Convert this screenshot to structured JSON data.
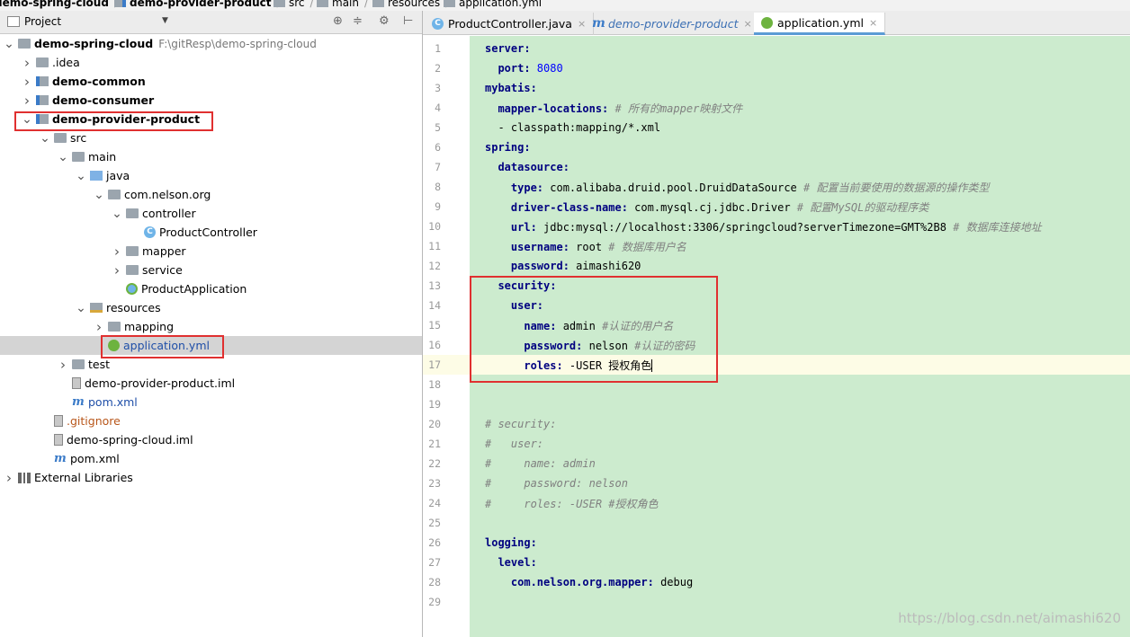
{
  "breadcrumb": [
    "demo-spring-cloud",
    "demo-provider-product",
    "src",
    "main",
    "resources",
    "application.yml"
  ],
  "project_panel": {
    "title": "Project"
  },
  "tree": [
    {
      "label": "demo-spring-cloud",
      "path": "F:\\gitResp\\demo-spring-cloud",
      "bold": true,
      "arrow": "open",
      "icon": "folder-icon",
      "depth": 0
    },
    {
      "label": ".idea",
      "arrow": "closed",
      "icon": "folder-icon",
      "depth": 1
    },
    {
      "label": "demo-common",
      "bold": true,
      "arrow": "closed",
      "icon": "module-folder-icon",
      "depth": 1
    },
    {
      "label": "demo-consumer",
      "bold": true,
      "arrow": "closed",
      "icon": "module-folder-icon",
      "depth": 1
    },
    {
      "label": "demo-provider-product",
      "bold": true,
      "arrow": "open",
      "icon": "module-folder-icon",
      "depth": 1
    },
    {
      "label": "src",
      "arrow": "open",
      "icon": "folder-icon",
      "depth": 2
    },
    {
      "label": "main",
      "arrow": "open",
      "icon": "folder-icon",
      "depth": 3
    },
    {
      "label": "java",
      "arrow": "open",
      "icon": "source-folder-icon",
      "depth": 4
    },
    {
      "label": "com.nelson.org",
      "arrow": "open",
      "icon": "package-icon",
      "depth": 5
    },
    {
      "label": "controller",
      "arrow": "open",
      "icon": "package-icon",
      "depth": 6
    },
    {
      "label": "ProductController",
      "arrow": "",
      "icon": "class-icon",
      "depth": 7
    },
    {
      "label": "mapper",
      "arrow": "closed",
      "icon": "package-icon",
      "depth": 6
    },
    {
      "label": "service",
      "arrow": "closed",
      "icon": "package-icon",
      "depth": 6
    },
    {
      "label": "ProductApplication",
      "arrow": "",
      "icon": "spring-class-icon",
      "depth": 6
    },
    {
      "label": "resources",
      "arrow": "open",
      "icon": "resources-folder-icon",
      "depth": 4
    },
    {
      "label": "mapping",
      "arrow": "closed",
      "icon": "folder-icon",
      "depth": 5
    },
    {
      "label": "application.yml",
      "arrow": "",
      "icon": "spring-yml-icon",
      "depth": 5,
      "selected": true,
      "blue": true
    },
    {
      "label": "test",
      "arrow": "closed",
      "icon": "folder-icon",
      "depth": 3
    },
    {
      "label": "demo-provider-product.iml",
      "arrow": "",
      "icon": "iml-file-icon",
      "depth": 3
    },
    {
      "label": "pom.xml",
      "arrow": "",
      "icon": "maven-icon",
      "depth": 3,
      "blue": true
    },
    {
      "label": ".gitignore",
      "arrow": "",
      "icon": "file-icon",
      "depth": 2,
      "orange": true
    },
    {
      "label": "demo-spring-cloud.iml",
      "arrow": "",
      "icon": "iml-file-icon",
      "depth": 2
    },
    {
      "label": "pom.xml",
      "arrow": "",
      "icon": "maven-icon",
      "depth": 2
    },
    {
      "label": "External Libraries",
      "arrow": "closed",
      "icon": "libraries-icon",
      "depth": 0
    }
  ],
  "tabs": [
    {
      "label": "ProductController.java",
      "icon": "C",
      "active": false
    },
    {
      "label": "demo-provider-product",
      "icon": "m",
      "active": false,
      "italic": true
    },
    {
      "label": "application.yml",
      "icon": "spring",
      "active": true
    }
  ],
  "close_glyph": "×",
  "code_lines": [
    [
      {
        "t": "server:",
        "c": "k"
      }
    ],
    [
      {
        "t": "  port: ",
        "c": "k"
      },
      {
        "t": "8080",
        "c": "n"
      }
    ],
    [
      {
        "t": "mybatis:",
        "c": "k"
      }
    ],
    [
      {
        "t": "  mapper-locations: ",
        "c": "k"
      },
      {
        "t": "# 所有的mapper映射文件",
        "c": "cm"
      }
    ],
    [
      {
        "t": "  - classpath:mapping/*.xml",
        "c": "v"
      }
    ],
    [
      {
        "t": "spring:",
        "c": "k"
      }
    ],
    [
      {
        "t": "  datasource:",
        "c": "k"
      }
    ],
    [
      {
        "t": "    type: ",
        "c": "k"
      },
      {
        "t": "com.alibaba.druid.pool.DruidDataSource ",
        "c": "v"
      },
      {
        "t": "# 配置当前要使用的数据源的操作类型",
        "c": "cm"
      }
    ],
    [
      {
        "t": "    driver-class-name: ",
        "c": "k"
      },
      {
        "t": "com.mysql.cj.jdbc.Driver ",
        "c": "v"
      },
      {
        "t": "# 配置MySQL的驱动程序类",
        "c": "cm"
      }
    ],
    [
      {
        "t": "    url: ",
        "c": "k"
      },
      {
        "t": "jdbc:mysql://localhost:3306/springcloud?serverTimezone=GMT%2B8 ",
        "c": "v"
      },
      {
        "t": "# 数据库连接地址",
        "c": "cm"
      }
    ],
    [
      {
        "t": "    username: ",
        "c": "k"
      },
      {
        "t": "root ",
        "c": "v"
      },
      {
        "t": "# 数据库用户名",
        "c": "cm"
      }
    ],
    [
      {
        "t": "    password: ",
        "c": "k"
      },
      {
        "t": "aimashi620",
        "c": "v"
      }
    ],
    [
      {
        "t": "  security:",
        "c": "k"
      }
    ],
    [
      {
        "t": "    user:",
        "c": "k"
      }
    ],
    [
      {
        "t": "      name: ",
        "c": "k"
      },
      {
        "t": "admin ",
        "c": "v"
      },
      {
        "t": "#认证的用户名",
        "c": "cm"
      }
    ],
    [
      {
        "t": "      password: ",
        "c": "k"
      },
      {
        "t": "nelson ",
        "c": "v"
      },
      {
        "t": "#认证的密码",
        "c": "cm"
      }
    ],
    [
      {
        "t": "      roles: ",
        "c": "k"
      },
      {
        "t": "-USER 授权角色",
        "c": "v"
      }
    ],
    [],
    [],
    [
      {
        "t": "# security:",
        "c": "cm"
      }
    ],
    [
      {
        "t": "#   user:",
        "c": "cm"
      }
    ],
    [
      {
        "t": "#     name: admin",
        "c": "cm"
      }
    ],
    [
      {
        "t": "#     password: nelson",
        "c": "cm"
      }
    ],
    [
      {
        "t": "#     roles: -USER #授权角色",
        "c": "cm"
      }
    ],
    [],
    [
      {
        "t": "logging:",
        "c": "k"
      }
    ],
    [
      {
        "t": "  level:",
        "c": "k"
      }
    ],
    [
      {
        "t": "    com.nelson.org.mapper: ",
        "c": "k"
      },
      {
        "t": "debug",
        "c": "v"
      }
    ],
    []
  ],
  "current_line": 17,
  "watermark": "https://blog.csdn.net/aimashi620"
}
